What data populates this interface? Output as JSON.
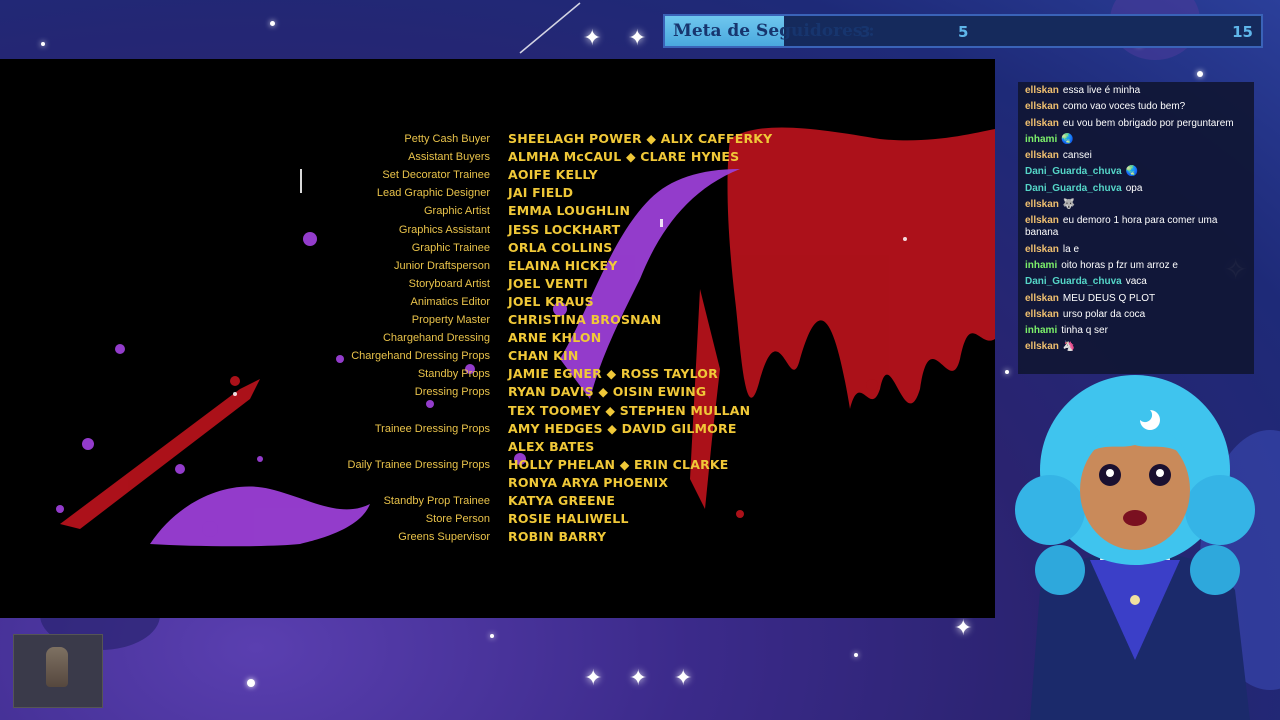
{
  "goal": {
    "title": "Meta de Seguidores :",
    "current": "3",
    "mid": "5",
    "max": "15",
    "progress": 0.2
  },
  "credits": [
    {
      "role": "Petty Cash Buyer",
      "names": "SHEELAGH POWER ◆ ALIX CAFFERKY"
    },
    {
      "role": "Assistant Buyers",
      "names": "ALMHA McCAUL ◆ CLARE HYNES"
    },
    {
      "role": "Set Decorator Trainee",
      "names": "AOIFE KELLY"
    },
    {
      "role": "Lead Graphic Designer",
      "names": "JAI FIELD"
    },
    {
      "role": "Graphic Artist",
      "names": "EMMA LOUGHLIN"
    },
    {
      "role": "Graphics Assistant",
      "names": "JESS LOCKHART"
    },
    {
      "role": "Graphic Trainee",
      "names": "ORLA COLLINS"
    },
    {
      "role": "Junior Draftsperson",
      "names": "ELAINA HICKEY"
    },
    {
      "role": "Storyboard Artist",
      "names": "JOEL VENTI"
    },
    {
      "role": "Animatics Editor",
      "names": "JOEL KRAUS"
    },
    {
      "role": "Property Master",
      "names": "CHRISTINA BROSNAN"
    },
    {
      "role": "Chargehand Dressing",
      "names": "ARNE KHLON"
    },
    {
      "role": "Chargehand Dressing Props",
      "names": "CHAN KIN"
    },
    {
      "role": "Standby Props",
      "names": "JAMIE EGNER ◆ ROSS TAYLOR"
    },
    {
      "role": "Dressing Props",
      "names": "RYAN DAVIS ◆ OISIN EWING"
    },
    {
      "role": "",
      "names": "TEX TOOMEY ◆ STEPHEN MULLAN"
    },
    {
      "role": "Trainee Dressing Props",
      "names": "AMY HEDGES ◆ DAVID GILMORE"
    },
    {
      "role": "",
      "names": "ALEX BATES"
    },
    {
      "role": "Daily Trainee Dressing Props",
      "names": "HOLLY PHELAN ◆ ERIN CLARKE"
    },
    {
      "role": "",
      "names": "RONYA ARYA PHOENIX"
    },
    {
      "role": "Standby Prop Trainee",
      "names": "KATYA GREENE"
    },
    {
      "role": "Store Person",
      "names": "ROSIE HALIWELL"
    },
    {
      "role": "Greens Supervisor",
      "names": "ROBIN BARRY"
    }
  ],
  "chat": [
    {
      "user": "ellskan",
      "color": "#f0c070",
      "text": "essa live é minha"
    },
    {
      "user": "ellskan",
      "color": "#f0c070",
      "text": "como vao voces tudo bem?"
    },
    {
      "user": "ellskan",
      "color": "#f0c070",
      "text": "eu vou bem obrigado por perguntarem"
    },
    {
      "user": "inhami",
      "color": "#7cf06a",
      "text": "🌏"
    },
    {
      "user": "ellskan",
      "color": "#f0c070",
      "text": "cansei"
    },
    {
      "user": "Dani_Guarda_chuva",
      "color": "#55d6c8",
      "text": "🌏"
    },
    {
      "user": "Dani_Guarda_chuva",
      "color": "#55d6c8",
      "text": "opa"
    },
    {
      "user": "ellskan",
      "color": "#f0c070",
      "text": "🐺"
    },
    {
      "user": "ellskan",
      "color": "#f0c070",
      "text": "eu demoro 1 hora para comer uma banana"
    },
    {
      "user": "ellskan",
      "color": "#f0c070",
      "text": "la e"
    },
    {
      "user": "inhami",
      "color": "#7cf06a",
      "text": "oito horas p fzr um arroz e"
    },
    {
      "user": "Dani_Guarda_chuva",
      "color": "#55d6c8",
      "text": "vaca"
    },
    {
      "user": "ellskan",
      "color": "#f0c070",
      "text": "MEU DEUS Q PLOT"
    },
    {
      "user": "ellskan",
      "color": "#f0c070",
      "text": "urso polar da coca"
    },
    {
      "user": "inhami",
      "color": "#7cf06a",
      "text": "tinha q ser"
    },
    {
      "user": "ellskan",
      "color": "#f0c070",
      "text": "🦄"
    }
  ]
}
